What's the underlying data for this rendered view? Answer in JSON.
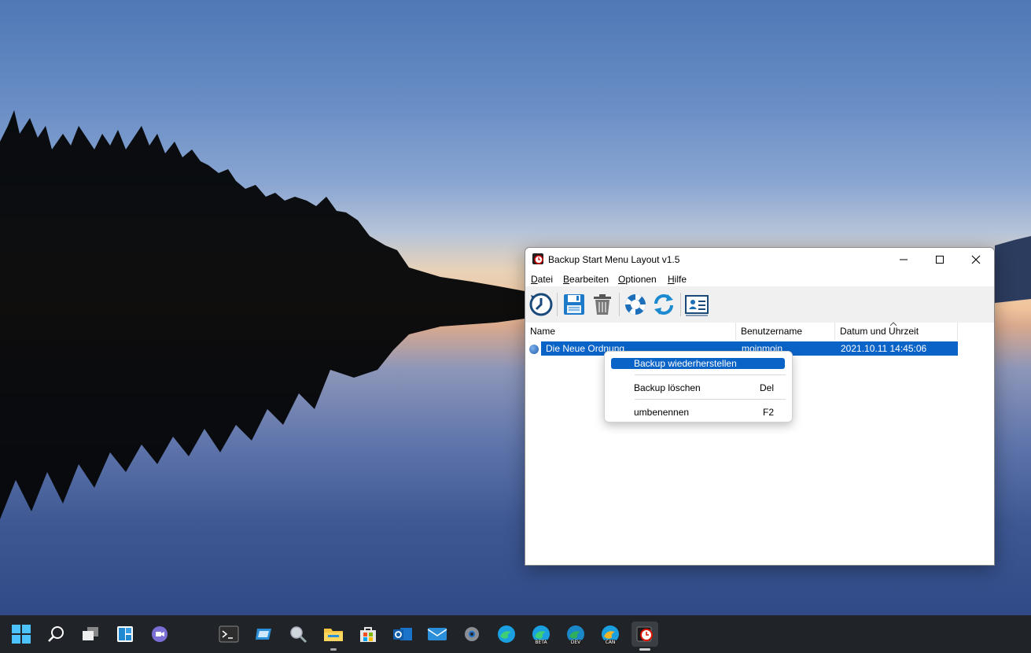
{
  "window": {
    "title": "Backup Start Menu Layout v1.5",
    "caption_buttons": [
      "minimize-icon",
      "maximize-icon",
      "close-icon"
    ]
  },
  "menubar": {
    "items": [
      {
        "label": "Datei",
        "accel": "D"
      },
      {
        "label": "Bearbeiten",
        "accel": "B"
      },
      {
        "label": "Optionen",
        "accel": "O"
      },
      {
        "label": "Hilfe",
        "accel": "H"
      }
    ]
  },
  "toolbar": {
    "icons": [
      "backup-clock-icon",
      "save-icon",
      "trash-icon",
      "lifebuoy-icon",
      "refresh-icon",
      "contact-card-icon"
    ]
  },
  "list": {
    "columns": [
      "Name",
      "Benutzername",
      "Datum und Uhrzeit"
    ],
    "rows": [
      {
        "name": "Die Neue Ordnung",
        "user": "moinmoin",
        "datetime": "2021.10.11 14:45:06",
        "selected": true
      }
    ]
  },
  "context_menu": {
    "items": [
      {
        "label": "Backup wiederherstellen",
        "shortcut": "",
        "highlighted": true
      },
      {
        "label": "Backup löschen",
        "shortcut": "Del"
      },
      {
        "label": "umbenennen",
        "shortcut": "F2"
      }
    ]
  },
  "taskbar": {
    "icons": [
      "start-icon",
      "search-icon",
      "task-view-icon",
      "widgets-icon",
      "chat-icon",
      "terminal-icon",
      "remote-icon",
      "magnifier-icon",
      "file-explorer-icon",
      "store-icon",
      "outlook-icon",
      "mail-icon",
      "settings-icon",
      "edge-icon",
      "edge-beta-icon",
      "edge-dev-icon",
      "edge-canary-icon",
      "backup-app-icon"
    ],
    "badges": {
      "edge_beta": "BETA",
      "edge_dev": "DEV",
      "edge_canary": "CAN"
    }
  },
  "colors": {
    "selection": "#0a64c8",
    "taskbar": "#202428",
    "toolbar": "#f0f0f0"
  }
}
